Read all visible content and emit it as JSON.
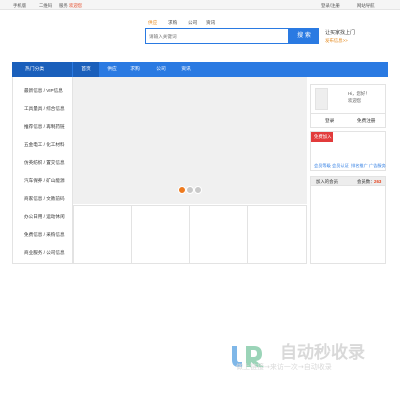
{
  "topbar": {
    "left": [
      "手机版",
      "二维码",
      "服务"
    ],
    "welcome": "欢迎您",
    "right": [
      "登录/注册",
      "网站导航"
    ]
  },
  "search": {
    "tabs": [
      "供应",
      "求购",
      "公司",
      "资讯"
    ],
    "placeholder": "请输入关键词",
    "button": "搜 索"
  },
  "slogan": "让买家找上门",
  "publish_link": "发布信息>>",
  "nav": {
    "category_label": "热门分类",
    "items": [
      "首页",
      "供应",
      "求购",
      "公司",
      "资讯"
    ],
    "active_index": 0
  },
  "categories": [
    "最新信息 / VIP信息",
    "工具量具 / 综合信息",
    "推荐信息 / 再制药链",
    "五金电工 / 化工材料",
    "仿英纺织 / 置交信息",
    "汽车保养 / 矿山能源",
    "商家信息 / 文教前码",
    "办公日用 / 运动休闲",
    "免费信息 / 采购信息",
    "商业服务 / 公司信息"
  ],
  "carousel": {
    "slide_count": 3,
    "active_index": 0
  },
  "user": {
    "hello": "Hi，您好！",
    "welcome": "欢迎您",
    "login": "登录",
    "register": "免费注册"
  },
  "free_join": {
    "badge": "免费加入",
    "services": [
      "会员等级",
      "会员认证",
      "排名推广",
      "广告服务"
    ]
  },
  "stats": {
    "label": "加入的会员",
    "prefix": "会员数：",
    "count": "263"
  },
  "watermark": {
    "title": "自动秒收录",
    "subtitle": "做上链接→来访一次→自动收录"
  },
  "colors": {
    "primary": "#2a7ae2",
    "primary_dark": "#1a5fbb",
    "accent": "#ee7a1e",
    "red": "#e23b3b"
  }
}
